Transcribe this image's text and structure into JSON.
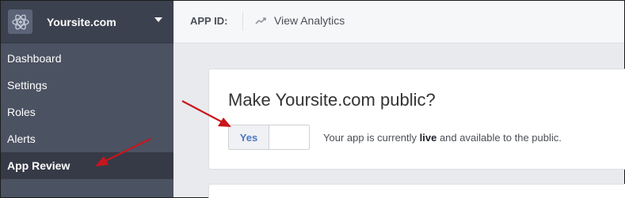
{
  "sidebar": {
    "site_name": "Yoursite.com",
    "items": [
      {
        "label": "Dashboard"
      },
      {
        "label": "Settings"
      },
      {
        "label": "Roles"
      },
      {
        "label": "Alerts"
      },
      {
        "label": "App Review",
        "active": true
      }
    ]
  },
  "topbar": {
    "app_id_label": "APP ID:",
    "analytics_label": "View Analytics"
  },
  "main": {
    "card_title": "Make Yoursite.com public?",
    "toggle_label": "Yes",
    "status_prefix": "Your app is currently ",
    "status_bold": "live",
    "status_suffix": " and available to the public."
  },
  "icons": {
    "app": "atom-icon",
    "dropdown": "caret-down-icon",
    "analytics": "trend-up-icon"
  },
  "colors": {
    "sidebar_bg": "#4b5261",
    "active_item_bg": "#363a46",
    "annotation_arrow": "#c8161d",
    "toggle_text": "#4a77c4"
  }
}
